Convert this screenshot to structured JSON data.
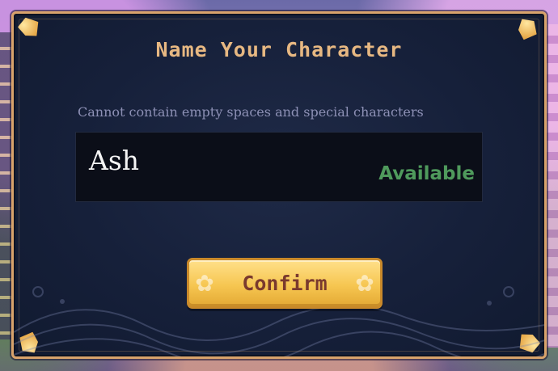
{
  "dialog": {
    "title": "Name Your Character",
    "hint": "Cannot contain empty spaces and special characters",
    "name_value": "Ash",
    "status_text": "Available",
    "confirm_label": "Confirm"
  },
  "colors": {
    "title": "#e7b882",
    "status_available": "#4f9a5c",
    "panel_border": "#d9a36b",
    "button_fill": "#f6c651",
    "button_text": "#7a3a2e"
  },
  "icons": [
    "corner-leaf-icon",
    "flower-icon"
  ]
}
